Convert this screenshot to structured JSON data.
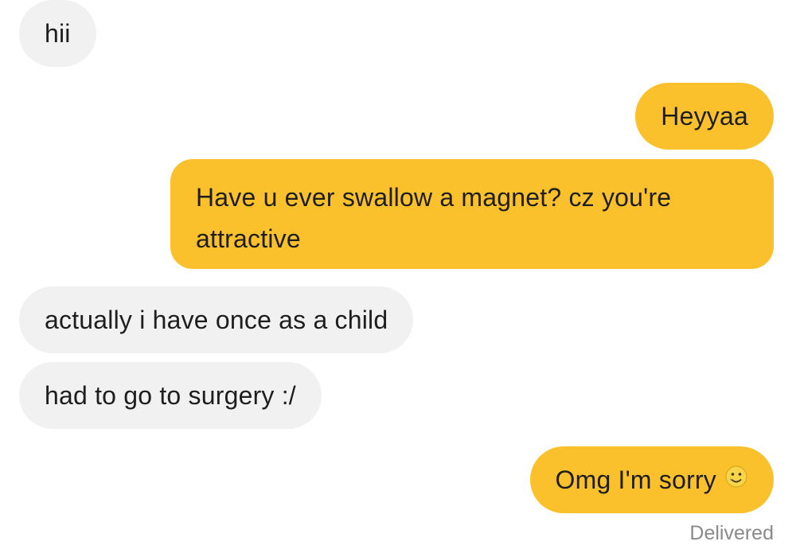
{
  "conversation": {
    "messages": [
      {
        "from": "them",
        "text": "hii"
      },
      {
        "from": "me",
        "text": "Heyyaa"
      },
      {
        "from": "me",
        "text": "Have u ever swallow a magnet? cz you're attractive"
      },
      {
        "from": "them",
        "text": "actually i have once as a child"
      },
      {
        "from": "them",
        "text": "had to go to surgery :/"
      },
      {
        "from": "me",
        "text": "Omg I'm sorry",
        "emoji": "smiling-face-with-tear-icon"
      }
    ],
    "status": "Delivered"
  },
  "colors": {
    "incoming_bubble": "#f1f1f1",
    "outgoing_bubble": "#fbc12d",
    "text": "#1e1e1e",
    "status_text": "#8a8a8a"
  }
}
